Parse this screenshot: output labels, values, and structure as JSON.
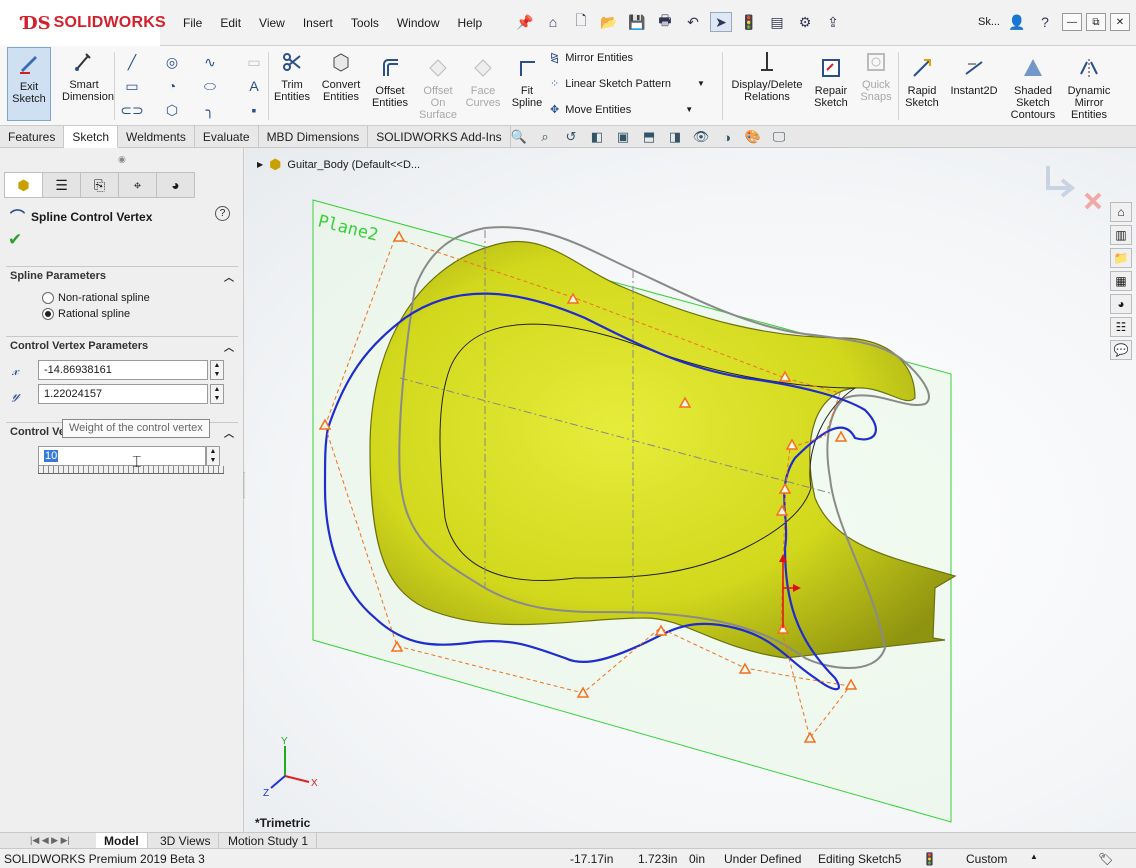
{
  "app": {
    "logo_text": "SOLIDWORKS"
  },
  "menus": [
    "File",
    "Edit",
    "View",
    "Insert",
    "Tools",
    "Window",
    "Help"
  ],
  "search_text": "Sk...",
  "toolbar": {
    "exit_sketch": "Exit Sketch",
    "smart_dimension": "Smart Dimension",
    "trim_entities": "Trim Entities",
    "convert_entities": "Convert Entities",
    "offset_entities": "Offset Entities",
    "offset_on_surface": "Offset On Surface",
    "face_curves": "Face Curves",
    "fit_spline": "Fit Spline",
    "mirror_entities": "Mirror Entities",
    "linear_sketch_pattern": "Linear Sketch Pattern",
    "move_entities": "Move Entities",
    "display_delete_relations": "Display/Delete Relations",
    "repair_sketch": "Repair Sketch",
    "quick_snaps": "Quick Snaps",
    "rapid_sketch": "Rapid Sketch",
    "instant2d": "Instant2D",
    "shaded_sketch_contours": "Shaded Sketch Contours",
    "dynamic_mirror_entities": "Dynamic Mirror Entities"
  },
  "tabs": [
    "Features",
    "Sketch",
    "Weldments",
    "Evaluate",
    "MBD Dimensions",
    "SOLIDWORKS Add-Ins"
  ],
  "property_manager": {
    "title": "Spline Control Vertex",
    "spline_parameters_header": "Spline Parameters",
    "non_rational": "Non-rational spline",
    "rational": "Rational spline",
    "control_vertex_parameters_header": "Control Vertex Parameters",
    "x_value": "-14.86938161",
    "y_value": "1.22024157",
    "weight_header": "Control Vertex Weight",
    "tooltip": "Weight of the control vertex",
    "weight_value": "10"
  },
  "viewport": {
    "tree_item": "Guitar_Body  (Default<<D...",
    "plane_label": "Plane2",
    "view_name": "*Trimetric",
    "triad": {
      "x": "X",
      "y": "Y",
      "z": "Z"
    }
  },
  "bottom_tabs": [
    "Model",
    "3D Views",
    "Motion Study 1"
  ],
  "status": {
    "product": "SOLIDWORKS Premium 2019 Beta 3",
    "x": "-17.17in",
    "y": "1.723in",
    "z": "0in",
    "state": "Under Defined",
    "editing": "Editing Sketch5",
    "units": "Custom"
  },
  "colors": {
    "brand": "#d41f2c",
    "body": "#d9e021",
    "spline": "#1f2ccf",
    "plane": "#39d039",
    "control_polygon": "#f07020"
  }
}
